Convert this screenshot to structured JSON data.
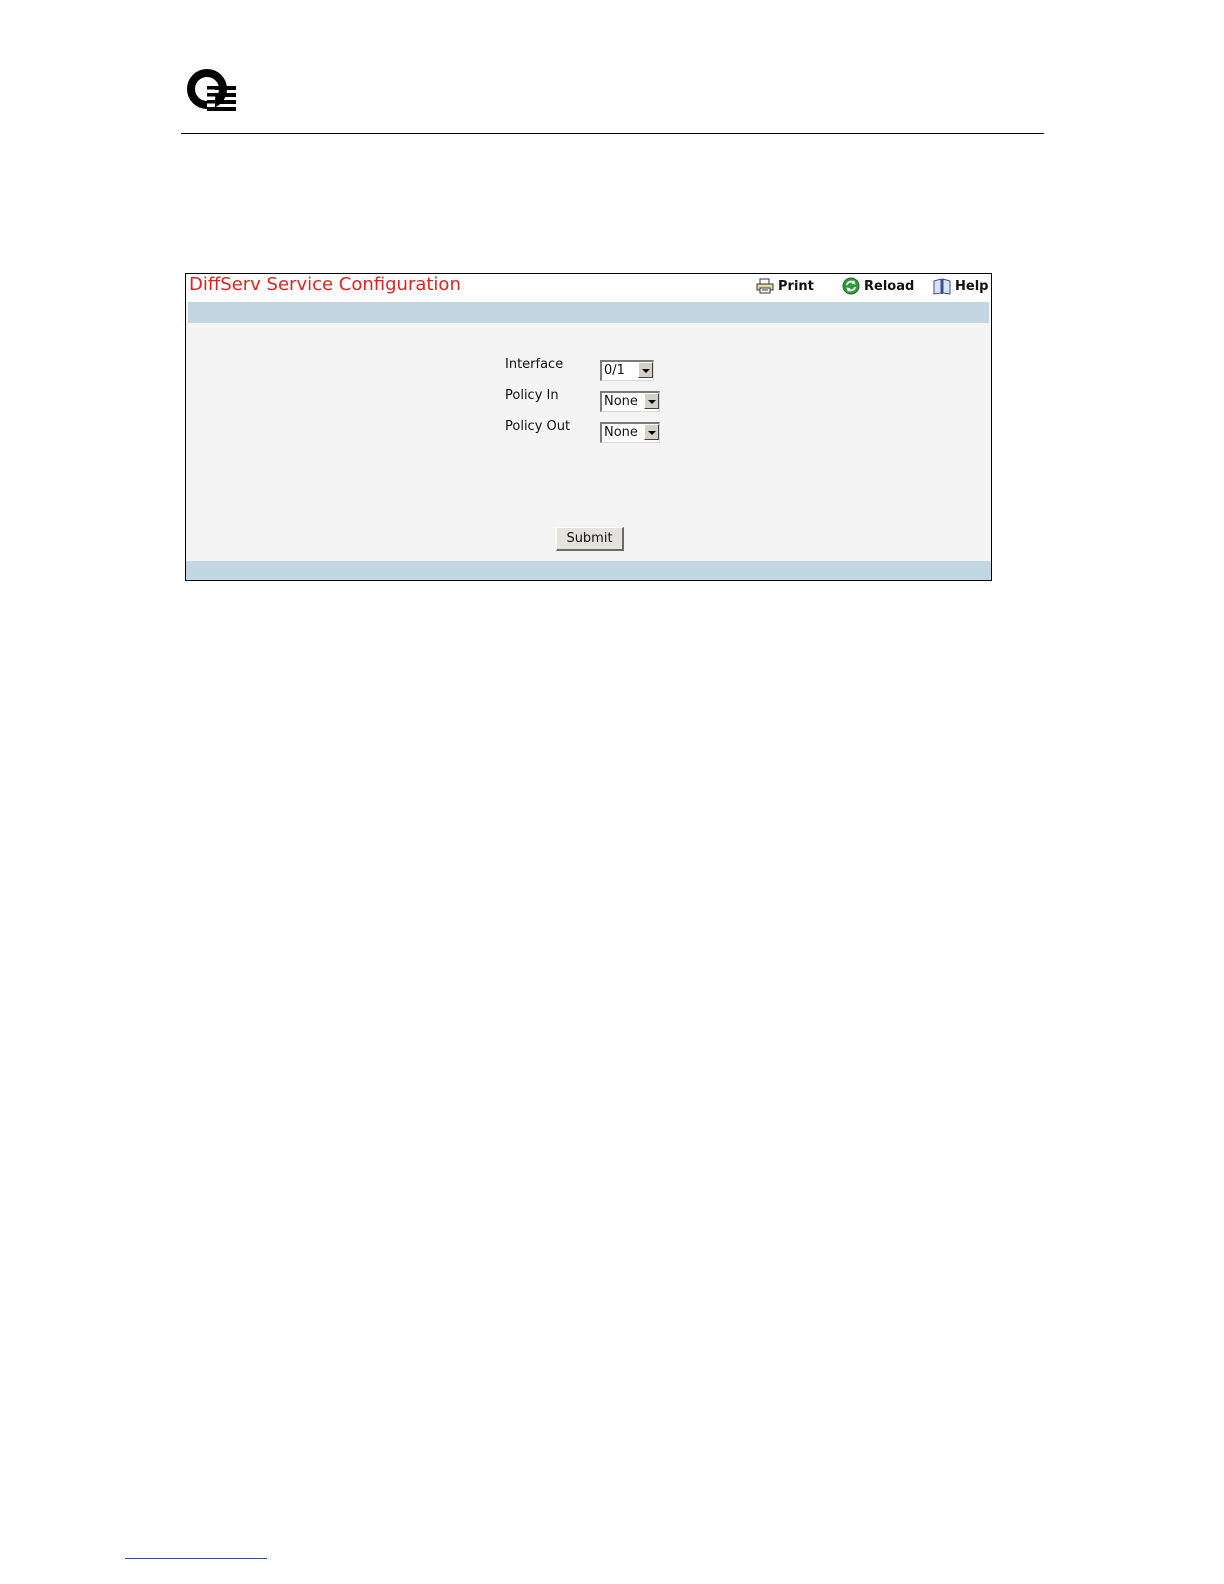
{
  "header": {
    "logo_icon": "q-logo-icon"
  },
  "panel": {
    "title": "DiffServ Service Configuration",
    "title_color": "#e8201c",
    "band_color": "#c2d7e2",
    "toolbar": {
      "print_label": "Print",
      "print_icon": "printer-icon",
      "reload_label": "Reload",
      "reload_icon": "reload-icon",
      "help_label": "Help",
      "help_icon": "help-book-icon"
    },
    "form": {
      "interface": {
        "label": "Interface",
        "value": "0/1"
      },
      "policy_in": {
        "label": "Policy In",
        "value": "None"
      },
      "policy_out": {
        "label": "Policy Out",
        "value": "None"
      },
      "submit_label": "Submit"
    }
  }
}
